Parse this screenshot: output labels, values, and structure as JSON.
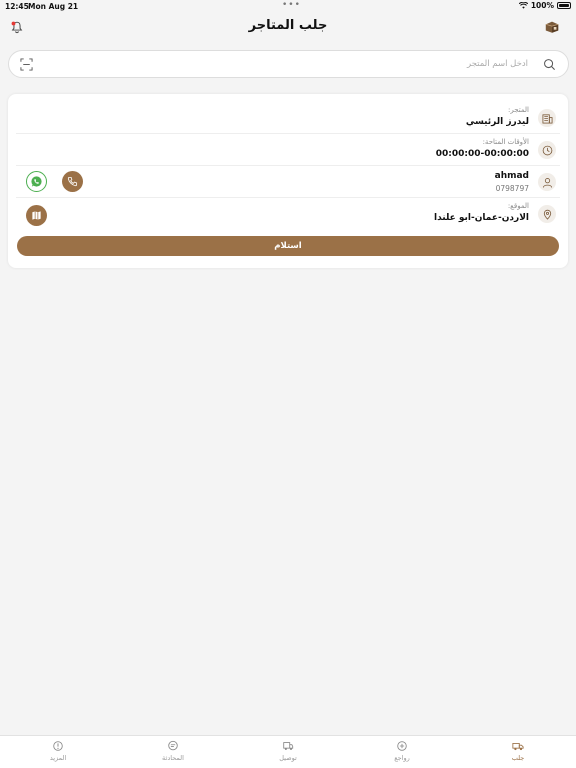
{
  "status_bar": {
    "time": "12:45",
    "date": "Mon Aug 21",
    "battery": "100%"
  },
  "header": {
    "title": "جلب المتاجر"
  },
  "search": {
    "placeholder": "ادخل اسم المتجر"
  },
  "store_card": {
    "store_label": "المتجر:",
    "store_value": "ليدرز الرئيسي",
    "hours_label": "الأوقات المتاحة:",
    "hours_value": "00:00:00-00:00:00",
    "contact_name": "ahmad",
    "contact_phone": "0798797",
    "location_label": "الموقع:",
    "location_value": "الاردن-عمان-ابو علندا",
    "receive_button": "استلام"
  },
  "tabs": [
    {
      "label": "جلب",
      "icon": "truck-icon",
      "active": true
    },
    {
      "label": "رواجع",
      "icon": "return-box-icon",
      "active": false
    },
    {
      "label": "توصيل",
      "icon": "delivery-icon",
      "active": false
    },
    {
      "label": "المحادثة",
      "icon": "chat-icon",
      "active": false
    },
    {
      "label": "المزيد",
      "icon": "more-icon",
      "active": false
    }
  ],
  "colors": {
    "accent": "#9b7147",
    "whatsapp": "#4caf50",
    "notify": "#e53935"
  }
}
